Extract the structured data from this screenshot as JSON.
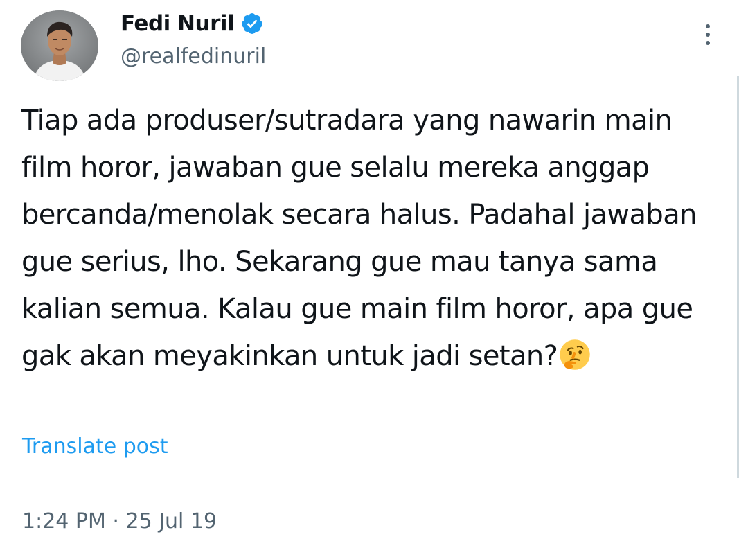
{
  "author": {
    "display_name": "Fedi Nuril",
    "handle": "@realfedinuril",
    "verified": true,
    "verified_color": "#1d9bf0"
  },
  "menu": {
    "more_icon": "more-vertical-icon"
  },
  "post": {
    "text": "Tiap ada produser/sutradara yang nawarin main film horor, jawaban gue selalu mereka anggap bercanda/menolak secara halus. Padahal jawaban gue serius, lho. Sekarang gue mau tanya sama kalian semua. Kalau gue main film horor, apa gue gak akan meyakinkan untuk jadi setan?",
    "emoji": "thinking-face-emoji",
    "translate_label": "Translate post",
    "timestamp": "1:24 PM · 25 Jul 19"
  },
  "colors": {
    "text": "#0f1419",
    "secondary": "#536471",
    "link": "#1d9bf0",
    "background": "#ffffff"
  }
}
